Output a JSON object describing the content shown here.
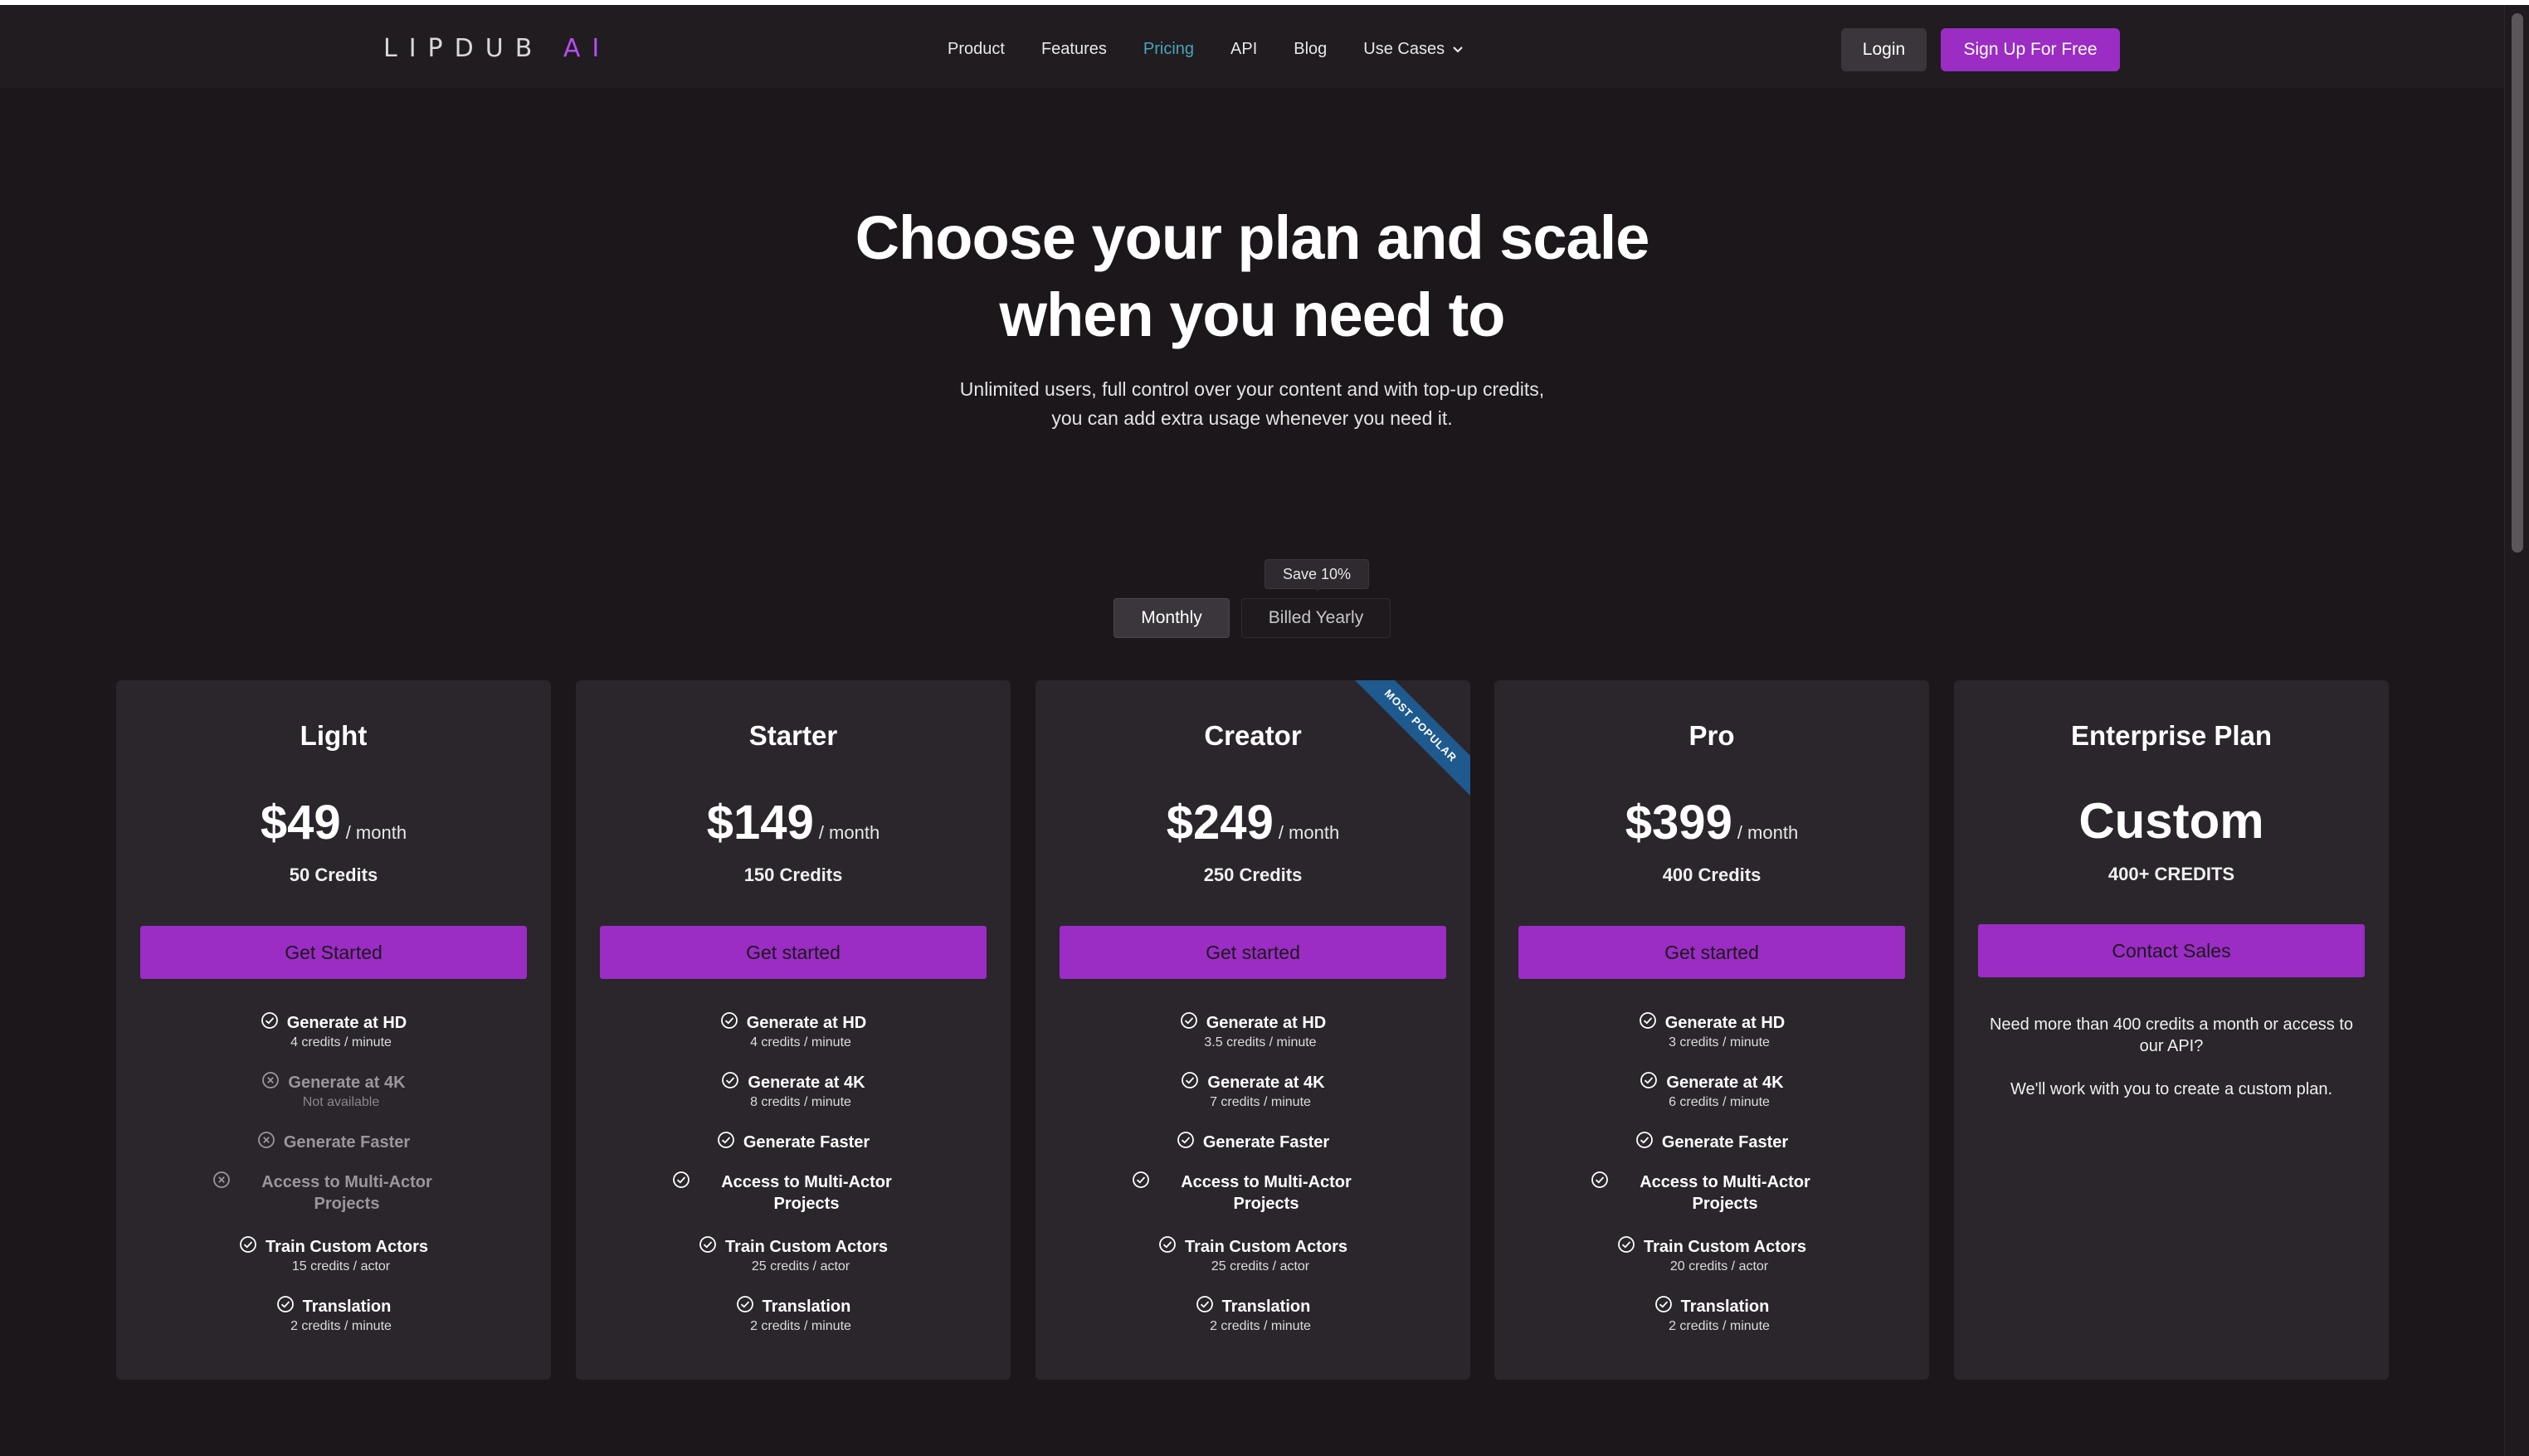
{
  "nav": {
    "logo_main": "LIPDUB ",
    "logo_ai": "AI",
    "links": [
      "Product",
      "Features",
      "Pricing",
      "API",
      "Blog"
    ],
    "dropdown": "Use Cases",
    "login": "Login",
    "signup": "Sign Up For Free",
    "active_link": "Pricing"
  },
  "hero": {
    "title_line1": "Choose your plan and scale",
    "title_line2": "when you need to",
    "subtitle_line1": "Unlimited users, full control over your content and with top-up credits,",
    "subtitle_line2": "you can add extra usage whenever you need it."
  },
  "billing": {
    "badge": "Save 10%",
    "monthly": "Monthly",
    "yearly": "Billed Yearly",
    "selected": "Monthly"
  },
  "plans": [
    {
      "name": "Light",
      "price": "$49",
      "per": "/ month",
      "credits": "50 Credits",
      "cta": "Get Started",
      "features": [
        {
          "title": "Generate at HD",
          "sub": "4 credits / minute",
          "available": true
        },
        {
          "title": "Generate at 4K",
          "sub": "Not available",
          "available": false
        },
        {
          "title": "Generate Faster",
          "sub": "",
          "available": false
        },
        {
          "title": "Access to Multi-Actor Projects",
          "sub": "",
          "available": false
        },
        {
          "title": "Train Custom Actors",
          "sub": "15 credits / actor",
          "available": true
        },
        {
          "title": "Translation",
          "sub": "2 credits / minute",
          "available": true
        }
      ]
    },
    {
      "name": "Starter",
      "price": "$149",
      "per": "/ month",
      "credits": "150 Credits",
      "cta": "Get started",
      "features": [
        {
          "title": "Generate at HD",
          "sub": "4 credits / minute",
          "available": true
        },
        {
          "title": "Generate at 4K",
          "sub": "8 credits / minute",
          "available": true
        },
        {
          "title": "Generate Faster",
          "sub": "",
          "available": true
        },
        {
          "title": "Access to Multi-Actor Projects",
          "sub": "",
          "available": true
        },
        {
          "title": "Train Custom Actors",
          "sub": "25 credits / actor",
          "available": true
        },
        {
          "title": "Translation",
          "sub": "2 credits / minute",
          "available": true
        }
      ]
    },
    {
      "name": "Creator",
      "price": "$249",
      "per": "/ month",
      "credits": "250 Credits",
      "cta": "Get started",
      "ribbon": "MOST POPULAR",
      "features": [
        {
          "title": "Generate at HD",
          "sub": "3.5 credits / minute",
          "available": true
        },
        {
          "title": "Generate at 4K",
          "sub": "7 credits / minute",
          "available": true
        },
        {
          "title": "Generate Faster",
          "sub": "",
          "available": true
        },
        {
          "title": "Access to Multi-Actor Projects",
          "sub": "",
          "available": true
        },
        {
          "title": "Train Custom Actors",
          "sub": "25 credits / actor",
          "available": true
        },
        {
          "title": "Translation",
          "sub": "2 credits / minute",
          "available": true
        }
      ]
    },
    {
      "name": "Pro",
      "price": "$399",
      "per": "/ month",
      "credits": "400 Credits",
      "cta": "Get started",
      "features": [
        {
          "title": "Generate at HD",
          "sub": "3 credits / minute",
          "available": true
        },
        {
          "title": "Generate at 4K",
          "sub": "6 credits / minute",
          "available": true
        },
        {
          "title": "Generate Faster",
          "sub": "",
          "available": true
        },
        {
          "title": "Access to Multi-Actor Projects",
          "sub": "",
          "available": true
        },
        {
          "title": "Train Custom Actors",
          "sub": "20 credits / actor",
          "available": true
        },
        {
          "title": "Translation",
          "sub": "2 credits / minute",
          "available": true
        }
      ]
    }
  ],
  "enterprise": {
    "name": "Enterprise Plan",
    "price": "Custom",
    "credits": "400+ CREDITS",
    "cta": "Contact Sales",
    "text1": "Need more than 400 credits a month or access to our API?",
    "text2": "We'll work with you to create a custom plan."
  },
  "colors": {
    "accent": "#9b2cc4",
    "background": "#1b171b",
    "card": "#2a262b",
    "active_nav": "#4aa3b8",
    "ribbon": "#1f5a8f"
  }
}
